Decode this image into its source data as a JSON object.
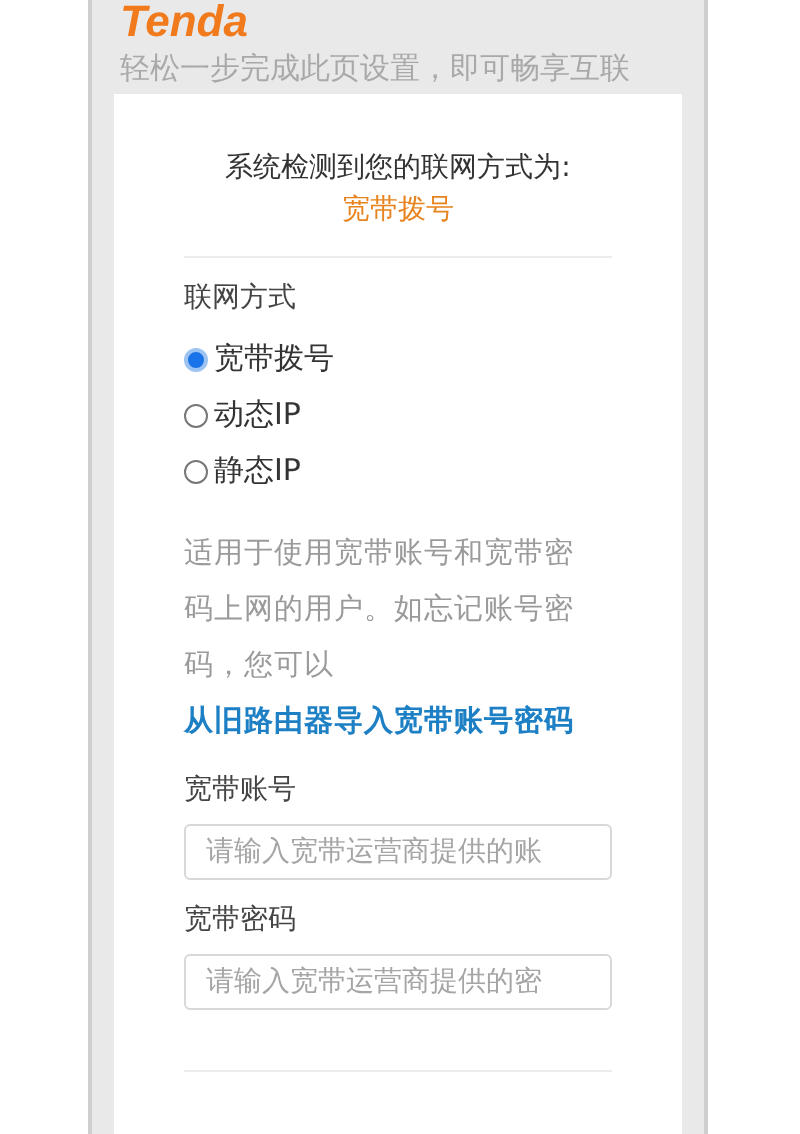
{
  "logo": "Tenda",
  "subtitle": "轻松一步完成此页设置，即可畅享互联",
  "detect": {
    "label": "系统检测到您的联网方式为:",
    "value": "宽带拨号"
  },
  "connection": {
    "label": "联网方式",
    "options": [
      {
        "label": "宽带拨号",
        "selected": true
      },
      {
        "label": "动态IP",
        "selected": false
      },
      {
        "label": "静态IP",
        "selected": false
      }
    ]
  },
  "description": {
    "text": "适用于使用宽带账号和宽带密码上网的用户。如忘记账号密码，您可以",
    "link": "从旧路由器导入宽带账号密码"
  },
  "fields": [
    {
      "label": "宽带账号",
      "placeholder": "请输入宽带运营商提供的账"
    },
    {
      "label": "宽带密码",
      "placeholder": "请输入宽带运营商提供的密"
    }
  ]
}
